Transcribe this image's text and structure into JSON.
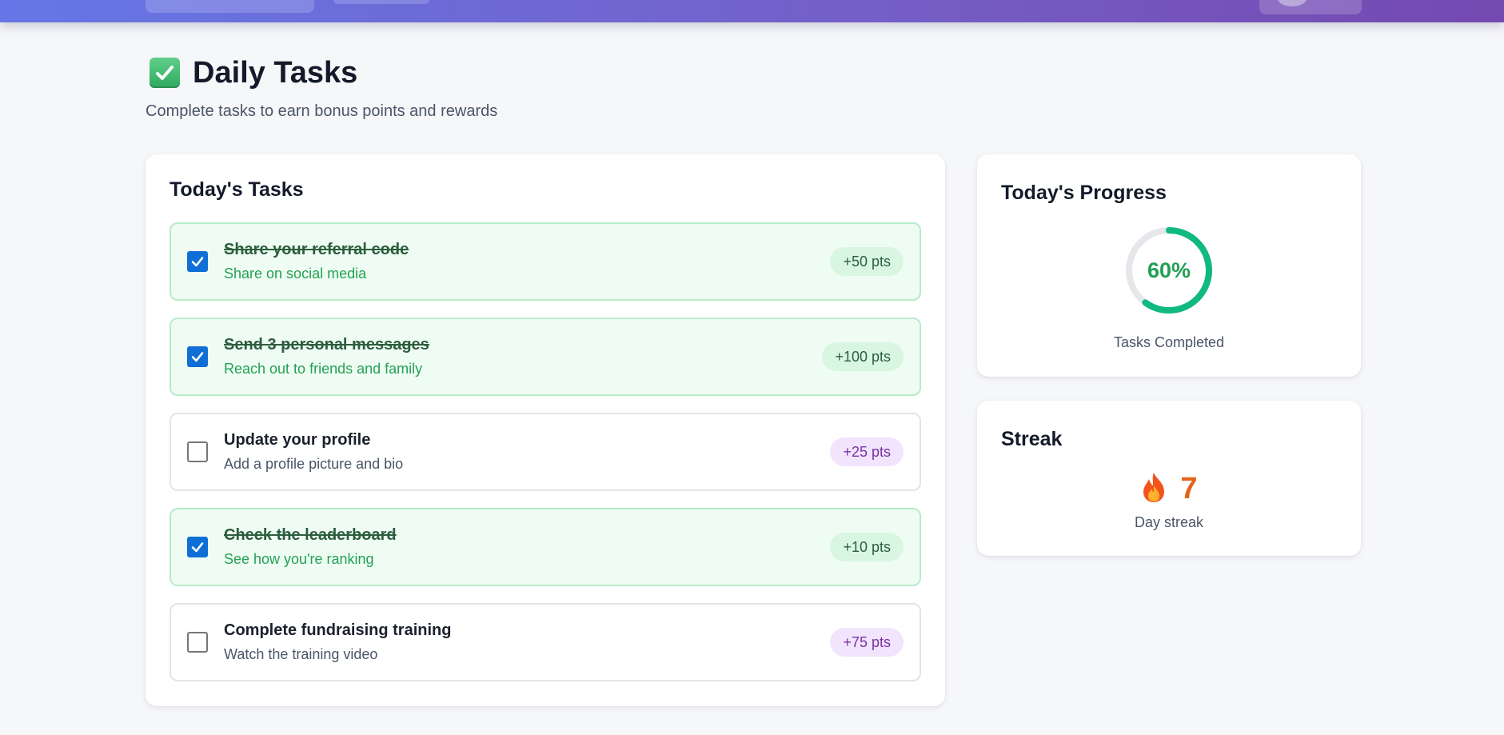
{
  "page": {
    "title": "Daily Tasks",
    "title_icon": "check-mark-button-icon",
    "subtitle": "Complete tasks to earn bonus points and rewards"
  },
  "tasks_card": {
    "title": "Today's Tasks",
    "tasks": [
      {
        "name": "Share your referral code",
        "desc": "Share on social media",
        "points": "+50 pts",
        "done": true
      },
      {
        "name": "Send 3 personal messages",
        "desc": "Reach out to friends and family",
        "points": "+100 pts",
        "done": true
      },
      {
        "name": "Update your profile",
        "desc": "Add a profile picture and bio",
        "points": "+25 pts",
        "done": false
      },
      {
        "name": "Check the leaderboard",
        "desc": "See how you're ranking",
        "points": "+10 pts",
        "done": true
      },
      {
        "name": "Complete fundraising training",
        "desc": "Watch the training video",
        "points": "+75 pts",
        "done": false
      }
    ]
  },
  "progress_card": {
    "title": "Today's Progress",
    "percent_label": "60%",
    "percent_value": 0.6,
    "caption": "Tasks Completed"
  },
  "streak_card": {
    "title": "Streak",
    "icon": "fire-icon",
    "count": "7",
    "caption": "Day streak"
  },
  "colors": {
    "topbar_start": "#6577e6",
    "topbar_end": "#7449b0",
    "done_bg": "#effcf3",
    "done_border": "#b7ecc8",
    "checkbox_checked": "#0f6fd6",
    "progress_ring": "#10b981",
    "progress_text": "#22a055",
    "streak_number": "#e2641b",
    "points_pending_bg": "#f1e4fc"
  }
}
